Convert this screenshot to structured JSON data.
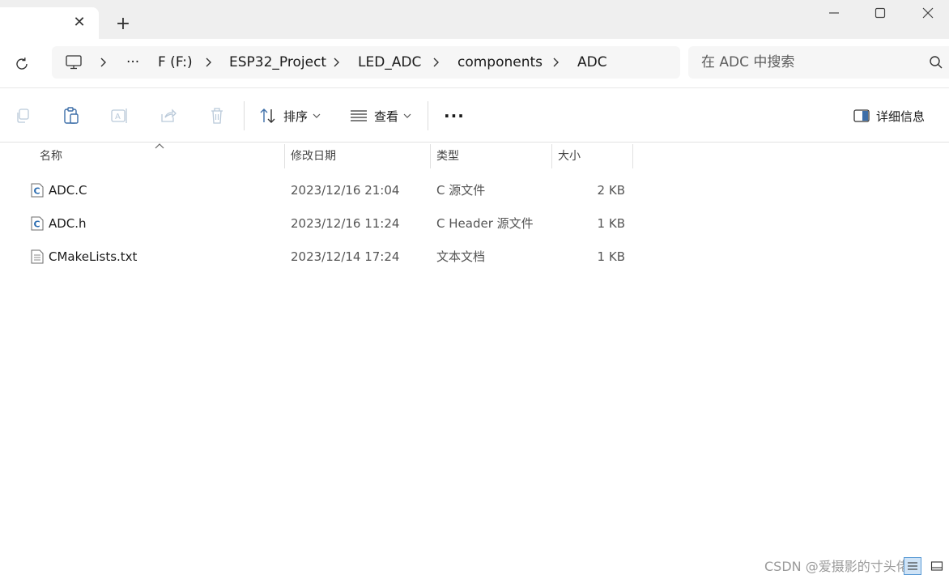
{
  "window": {
    "tab_close_glyph": "✕",
    "new_tab_glyph": "+",
    "controls": [
      "minimize-icon",
      "maximize-icon",
      "close-icon"
    ]
  },
  "breadcrumb": {
    "overflow": "···",
    "items": [
      "F (F:)",
      "ESP32_Project",
      "LED_ADC",
      "components",
      "ADC"
    ]
  },
  "search": {
    "placeholder": "在 ADC 中搜索"
  },
  "toolbar": {
    "sort_label": "排序",
    "view_label": "查看",
    "more_label": "···",
    "details_label": "详细信息"
  },
  "columns": {
    "name": "名称",
    "modified": "修改日期",
    "type": "类型",
    "size": "大小"
  },
  "files": [
    {
      "name": "ADC.C",
      "modified": "2023/12/16 21:04",
      "type": "C 源文件",
      "size": "2 KB",
      "icon": "c-source-file-icon"
    },
    {
      "name": "ADC.h",
      "modified": "2023/12/16 11:24",
      "type": "C Header 源文件",
      "size": "1 KB",
      "icon": "c-header-file-icon"
    },
    {
      "name": "CMakeLists.txt",
      "modified": "2023/12/14 17:24",
      "type": "文本文档",
      "size": "1 KB",
      "icon": "text-file-icon"
    }
  ],
  "watermark": "CSDN @爱摄影的寸头佬",
  "colors": {
    "accent": "#0067c0",
    "selected_view_bg": "#cfe3f6",
    "chrome_bg": "#efefef"
  }
}
